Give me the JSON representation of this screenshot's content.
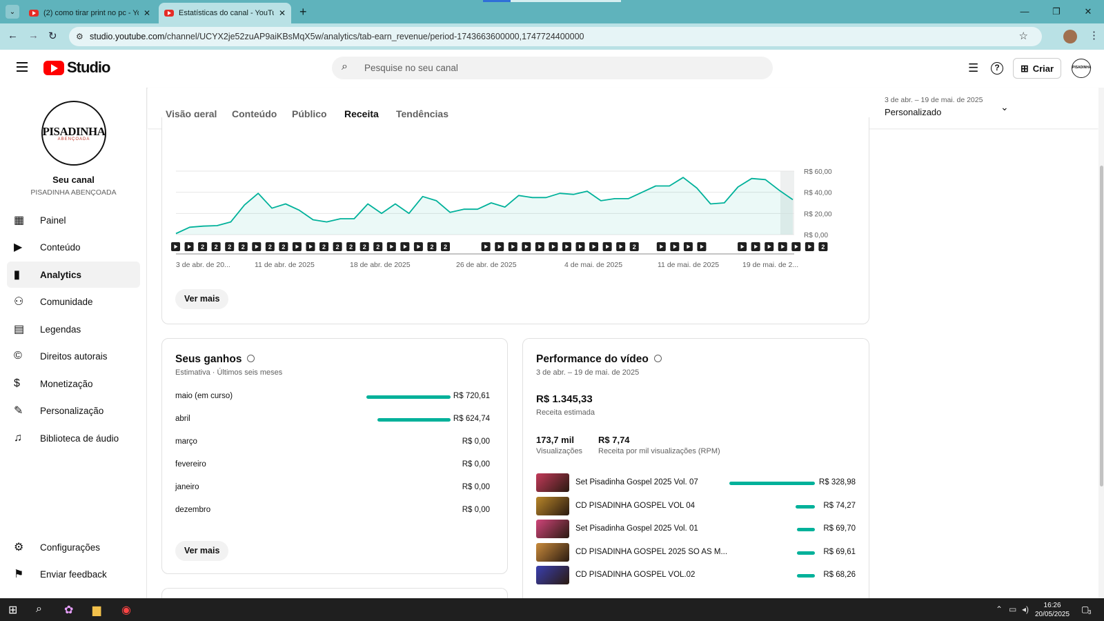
{
  "browser": {
    "tabs": [
      {
        "title": "(2) como tirar print no pc - YouTube",
        "active": false
      },
      {
        "title": "Estatísticas do canal - YouTube Studio",
        "active": true
      }
    ],
    "url_host": "studio.youtube.com",
    "url_path": "/channel/UCYX2je52zuAP9aiKBsMqX5w/analytics/tab-earn_revenue/period-1743663600000,1747724400000"
  },
  "header": {
    "logo_text": "Studio",
    "search_placeholder": "Pesquise no seu canal",
    "create_label": "Criar"
  },
  "sidebar": {
    "avatar_line1": "PISADINHA",
    "avatar_line2": "ABENÇOADA",
    "channel_label": "Seu canal",
    "channel_name": "PISADINHA ABENÇOADA",
    "items": [
      {
        "label": "Painel",
        "icon": "dashboard-icon"
      },
      {
        "label": "Conteúdo",
        "icon": "content-icon"
      },
      {
        "label": "Analytics",
        "icon": "analytics-icon",
        "active": true
      },
      {
        "label": "Comunidade",
        "icon": "community-icon"
      },
      {
        "label": "Legendas",
        "icon": "subtitles-icon"
      },
      {
        "label": "Direitos autorais",
        "icon": "copyright-icon"
      },
      {
        "label": "Monetização",
        "icon": "monetization-icon"
      },
      {
        "label": "Personalização",
        "icon": "customization-icon"
      },
      {
        "label": "Biblioteca de áudio",
        "icon": "audio-library-icon"
      }
    ],
    "settings_label": "Configurações",
    "feedback_label": "Enviar feedback"
  },
  "analytics_tabs": [
    "Visão geral",
    "Conteúdo",
    "Público",
    "Receita",
    "Tendências"
  ],
  "period": {
    "range": "3 de abr. – 19 de mai. de 2025",
    "label": "Personalizado"
  },
  "chart_data": {
    "type": "area",
    "y_ticks": [
      "R$ 60,00",
      "R$ 40,00",
      "R$ 20,00",
      "R$ 0,00"
    ],
    "ylim": [
      0,
      60
    ],
    "x_tick_labels": [
      "3 de abr. de 20...",
      "11 de abr. de 2025",
      "18 de abr. de 2025",
      "26 de abr. de 2025",
      "4 de mai. de 2025",
      "11 de mai. de 2025",
      "19 de mai. de 2..."
    ],
    "color": "#00b19a",
    "values": [
      1,
      7,
      8,
      8.5,
      12,
      28,
      39,
      25,
      29,
      23,
      14,
      12,
      15,
      15,
      29,
      20,
      29,
      20,
      36,
      32,
      21,
      24,
      24,
      30,
      26,
      37,
      35,
      35,
      39,
      38,
      41,
      32,
      34,
      34,
      40,
      46,
      46,
      54,
      44,
      29,
      30,
      45,
      53,
      52,
      42,
      33
    ]
  },
  "markers": [
    "p",
    "p",
    "2",
    "2",
    "2",
    "2",
    "p",
    "2",
    "2",
    "p",
    "p",
    "2",
    "2",
    "2",
    "2",
    "2",
    "p",
    "p",
    "p",
    "2",
    "2",
    "",
    "",
    "p",
    "p",
    "p",
    "p",
    "p",
    "p",
    "p",
    "p",
    "p",
    "p",
    "p",
    "2",
    "",
    "p",
    "p",
    "p",
    "p",
    "",
    "",
    "p",
    "p",
    "p",
    "p",
    "p",
    "p",
    "2"
  ],
  "see_more": "Ver mais",
  "earnings": {
    "title": "Seus ganhos",
    "subtitle": "Estimativa · Últimos seis meses",
    "rows": [
      {
        "month": "maio (em curso)",
        "value": "R$ 720,61",
        "amount": 720.61
      },
      {
        "month": "abril",
        "value": "R$ 624,74",
        "amount": 624.74
      },
      {
        "month": "março",
        "value": "R$ 0,00",
        "amount": 0
      },
      {
        "month": "fevereiro",
        "value": "R$ 0,00",
        "amount": 0
      },
      {
        "month": "janeiro",
        "value": "R$ 0,00",
        "amount": 0
      },
      {
        "month": "dezembro",
        "value": "R$ 0,00",
        "amount": 0
      }
    ]
  },
  "performance": {
    "title": "Performance do vídeo",
    "period": "3 de abr. – 19 de mai. de 2025",
    "revenue": "R$ 1.345,33",
    "revenue_label": "Receita estimada",
    "views": "173,7 mil",
    "views_label": "Visualizações",
    "rpm": "R$ 7,74",
    "rpm_label": "Receita por mil visualizações (RPM)",
    "videos": [
      {
        "title": "Set Pisadinha Gospel 2025 Vol. 07",
        "value": "R$ 328,98",
        "amount": 328.98,
        "thumb": "#c23a5a"
      },
      {
        "title": "CD PISADINHA GOSPEL VOL 04",
        "value": "R$ 74,27",
        "amount": 74.27,
        "thumb": "#b8862a"
      },
      {
        "title": "Set Pisadinha Gospel 2025 Vol. 01",
        "value": "R$ 69,70",
        "amount": 69.7,
        "thumb": "#d0457a"
      },
      {
        "title": "CD PISADINHA GOSPEL 2025 SO AS M...",
        "value": "R$ 69,61",
        "amount": 69.61,
        "thumb": "#c98b3c"
      },
      {
        "title": "CD PISADINHA GOSPEL VOL.02",
        "value": "R$ 68,26",
        "amount": 68.26,
        "thumb": "#3a3fb0"
      }
    ]
  },
  "taskbar": {
    "time": "16:26",
    "date": "20/05/2025",
    "notifications": "3"
  }
}
